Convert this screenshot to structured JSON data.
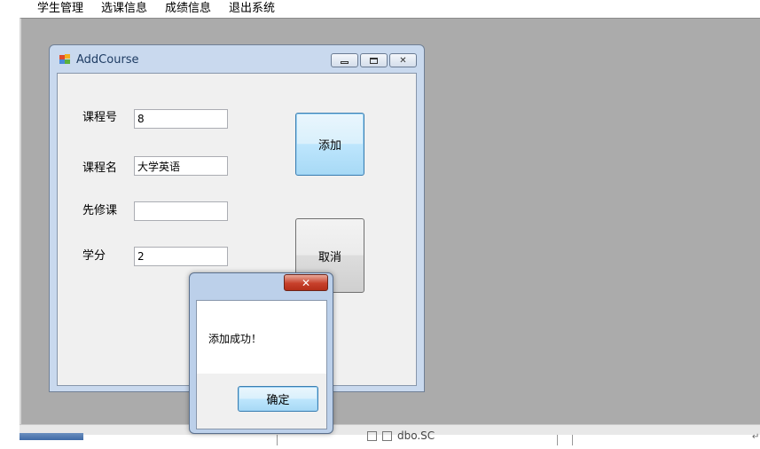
{
  "menubar": {
    "items": [
      {
        "label": "学生管理"
      },
      {
        "label": "选课信息"
      },
      {
        "label": "成绩信息"
      },
      {
        "label": "退出系统"
      }
    ]
  },
  "add_course_window": {
    "title": "AddCourse",
    "fields": {
      "course_no": {
        "label": "课程号",
        "value": "8"
      },
      "course_name": {
        "label": "课程名",
        "value": "大学英语"
      },
      "prerequisite": {
        "label": "先修课",
        "value": ""
      },
      "credit": {
        "label": "学分",
        "value": "2"
      }
    },
    "add_button": "添加",
    "cancel_button": "取消"
  },
  "message_box": {
    "close_glyph": "✕",
    "text": "添加成功！",
    "ok_button": "确定"
  },
  "background_fragment": {
    "text": "dbo.SC"
  },
  "colors": {
    "mdi_background": "#ababab",
    "window_frame": "#c9d9ee",
    "client_background": "#f0f0f0",
    "close_button": "#c7402b",
    "focus_border": "#3c7fb1"
  }
}
